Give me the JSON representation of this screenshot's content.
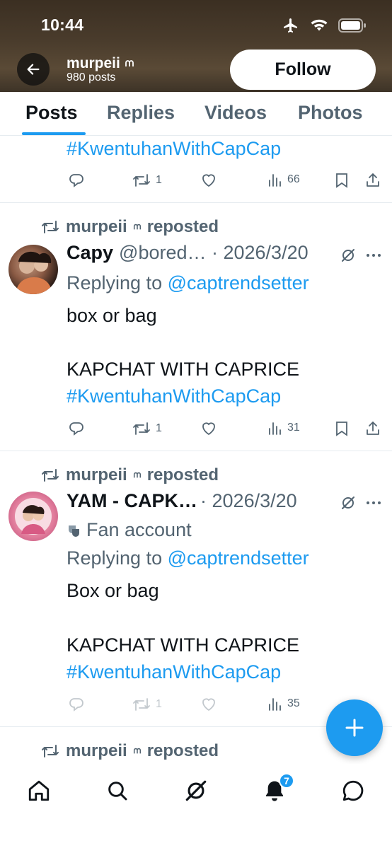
{
  "status_bar": {
    "time": "10:44"
  },
  "profile": {
    "name": "murpeii",
    "post_count": "980 posts"
  },
  "follow_button": {
    "label": "Follow"
  },
  "tabs": [
    {
      "label": "Posts",
      "active": true
    },
    {
      "label": "Replies",
      "active": false
    },
    {
      "label": "Videos",
      "active": false
    },
    {
      "label": "Photos",
      "active": false
    }
  ],
  "feed": {
    "partial_post": {
      "hashtag": "#KwentuhanWithCapCap",
      "retweets": "1",
      "views": "66"
    },
    "posts": [
      {
        "repost_label": "murpeii",
        "repost_suffix": "reposted",
        "display_name": "Capy",
        "meta": "@bored… · 2026/3/20",
        "reply_prefix": "Replying to",
        "reply_handle": "@captrendsetter",
        "text_line_1": "box or bag",
        "text_line_2": "KAPCHAT WITH CAPRICE",
        "hashtag": "#KwentuhanWithCapCap",
        "retweets": "1",
        "views": "31"
      },
      {
        "repost_label": "murpeii",
        "repost_suffix": "reposted",
        "display_name": "YAM - CAPK…",
        "meta": " · 2026/3/20",
        "fan_label": "Fan account",
        "reply_prefix": "Replying to",
        "reply_handle": "@captrendsetter",
        "text_line_1": "Box or bag",
        "text_line_2": "KAPCHAT WITH CAPRICE",
        "hashtag": "#KwentuhanWithCapCap",
        "retweets": "1",
        "views": "35"
      },
      {
        "repost_label": "murpeii",
        "repost_suffix": "reposted"
      }
    ]
  },
  "bottom_nav": {
    "notification_count": "7"
  },
  "colors": {
    "accent": "#1d9bf0",
    "text": "#0f1419",
    "secondary": "#536471"
  }
}
